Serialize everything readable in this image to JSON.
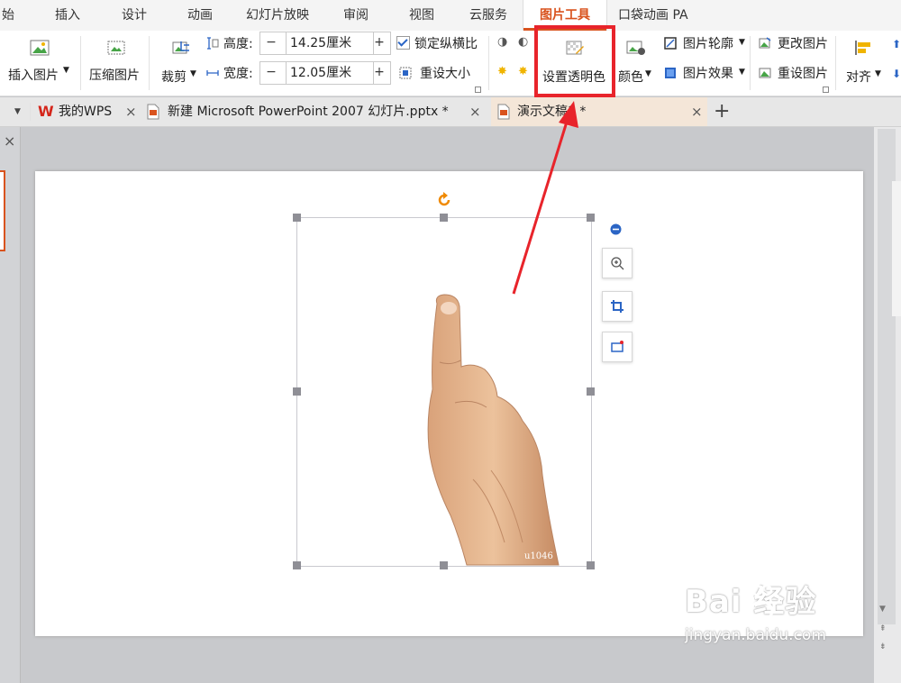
{
  "menu": {
    "tabs": [
      "始",
      "插入",
      "设计",
      "动画",
      "幻灯片放映",
      "审阅",
      "视图",
      "云服务"
    ],
    "active_tab": "图片工具",
    "extra_tab": "口袋动画 PA"
  },
  "ribbon": {
    "insert_picture": "插入图片",
    "compress_picture": "压缩图片",
    "crop": "裁剪",
    "height_label": "高度:",
    "height_value": "14.25厘米",
    "width_label": "宽度:",
    "width_value": "12.05厘米",
    "minus": "−",
    "plus": "+",
    "lock_ratio": "锁定纵横比",
    "reset_size": "重设大小",
    "set_transparent": "设置透明色",
    "color": "颜色",
    "picture_outline": "图片轮廓",
    "picture_effect": "图片效果",
    "change_picture": "更改图片",
    "reset_picture": "重设图片",
    "align": "对齐"
  },
  "doc_tabs": {
    "my_wps": "我的WPS",
    "pptx": "新建 Microsoft PowerPoint 2007 幻灯片.pptx *",
    "active": "演示文稿1 *",
    "close": "×",
    "add": "+"
  },
  "slide": {
    "image_caption": "u1046"
  },
  "watermark": {
    "brand": "Bai 经验",
    "url": "jingyan.baidu.com"
  },
  "colors": {
    "accent": "#d9531e",
    "highlight_box": "#e8242b",
    "arrow": "#e8242b"
  }
}
